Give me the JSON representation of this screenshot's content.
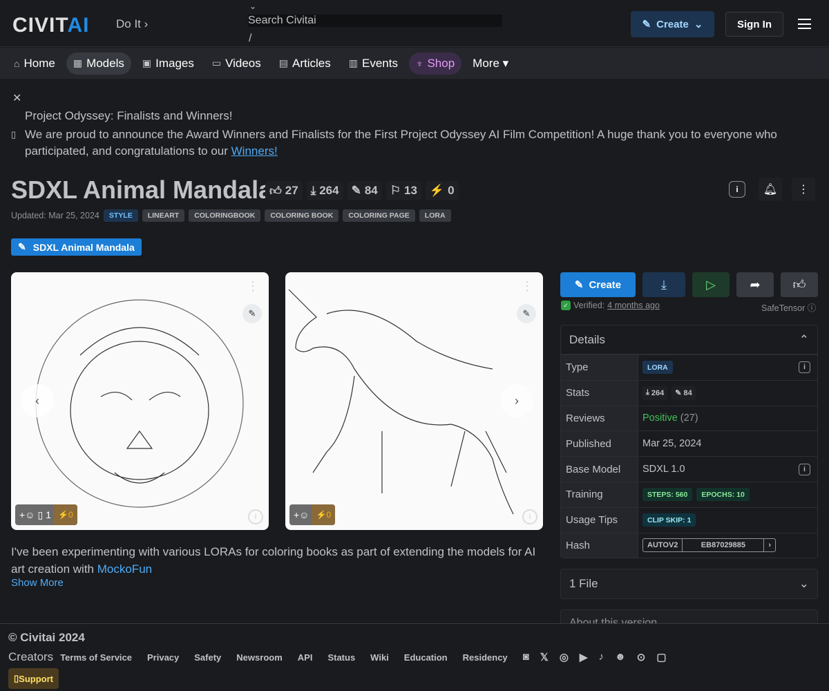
{
  "header": {
    "logo_main": "CIVIT",
    "logo_accent": "AI",
    "doit": "Do It ›",
    "search_placeholder": "Search Civitai",
    "search_hint": "/",
    "create": "Create",
    "sign_in": "Sign In"
  },
  "nav": [
    {
      "label": "Home",
      "icon": "⌂"
    },
    {
      "label": "Models",
      "icon": "▦"
    },
    {
      "label": "Images",
      "icon": "▣"
    },
    {
      "label": "Videos",
      "icon": "▭"
    },
    {
      "label": "Articles",
      "icon": "▤"
    },
    {
      "label": "Events",
      "icon": "▥"
    },
    {
      "label": "Shop",
      "icon": "♆"
    },
    {
      "label": "More ▾",
      "icon": ""
    }
  ],
  "announcement": {
    "title": "Project Odyssey: Finalists and Winners!",
    "body": "We are proud to announce the Award Winners and Finalists for the First Project Odyssey AI Film Competition! A huge thank you to everyone who participated, and congratulations to our ",
    "link": "Winners!"
  },
  "model": {
    "title": "SDXL Animal Mandala",
    "likes": "27",
    "downloads": "264",
    "generations": "84",
    "bookmarks": "13",
    "buzz": "0",
    "updated": "Updated: Mar 25, 2024",
    "tags": [
      "STYLE",
      "LINEART",
      "COLORINGBOOK",
      "COLORING BOOK",
      "COLORING PAGE",
      "LORA"
    ],
    "version": "SDXL Animal Mandala"
  },
  "cards": [
    {
      "reactions_count": "1",
      "buzz": "0"
    },
    {
      "buzz": "0"
    }
  ],
  "description": {
    "text": "I've been experimenting with various LORAs for coloring books as part of extending the models for AI art creation with ",
    "link": "MockoFun",
    "show_more": "Show More"
  },
  "actions": {
    "create": "Create"
  },
  "verified": {
    "label": "Verified:",
    "when": "4 months ago",
    "format": "SafeTensor"
  },
  "details": {
    "title": "Details",
    "type_label": "Type",
    "type": "LORA",
    "stats_label": "Stats",
    "stats_downloads": "264",
    "stats_generations": "84",
    "reviews_label": "Reviews",
    "reviews": "Positive",
    "reviews_count": "(27)",
    "published_label": "Published",
    "published": "Mar 25, 2024",
    "base_label": "Base Model",
    "base": "SDXL 1.0",
    "training_label": "Training",
    "steps": "STEPS: 560",
    "epochs": "EPOCHS: 10",
    "tips_label": "Usage Tips",
    "clip": "CLIP SKIP: 1",
    "hash_label": "Hash",
    "hash_type": "AUTOV2",
    "hash": "EB87029885"
  },
  "files": "1 File",
  "about": "About this version",
  "footer": {
    "copyright": "© Civitai 2024",
    "creators": "Creators",
    "links": [
      "Terms of Service",
      "Privacy",
      "Safety",
      "Newsroom",
      "API",
      "Status",
      "Wiki",
      "Education",
      "Residency"
    ],
    "support": "Support"
  },
  "colors": {
    "accent": "#228be6",
    "bg": "#1a1b1e",
    "positive": "#40c057",
    "buzz": "#fab005"
  }
}
